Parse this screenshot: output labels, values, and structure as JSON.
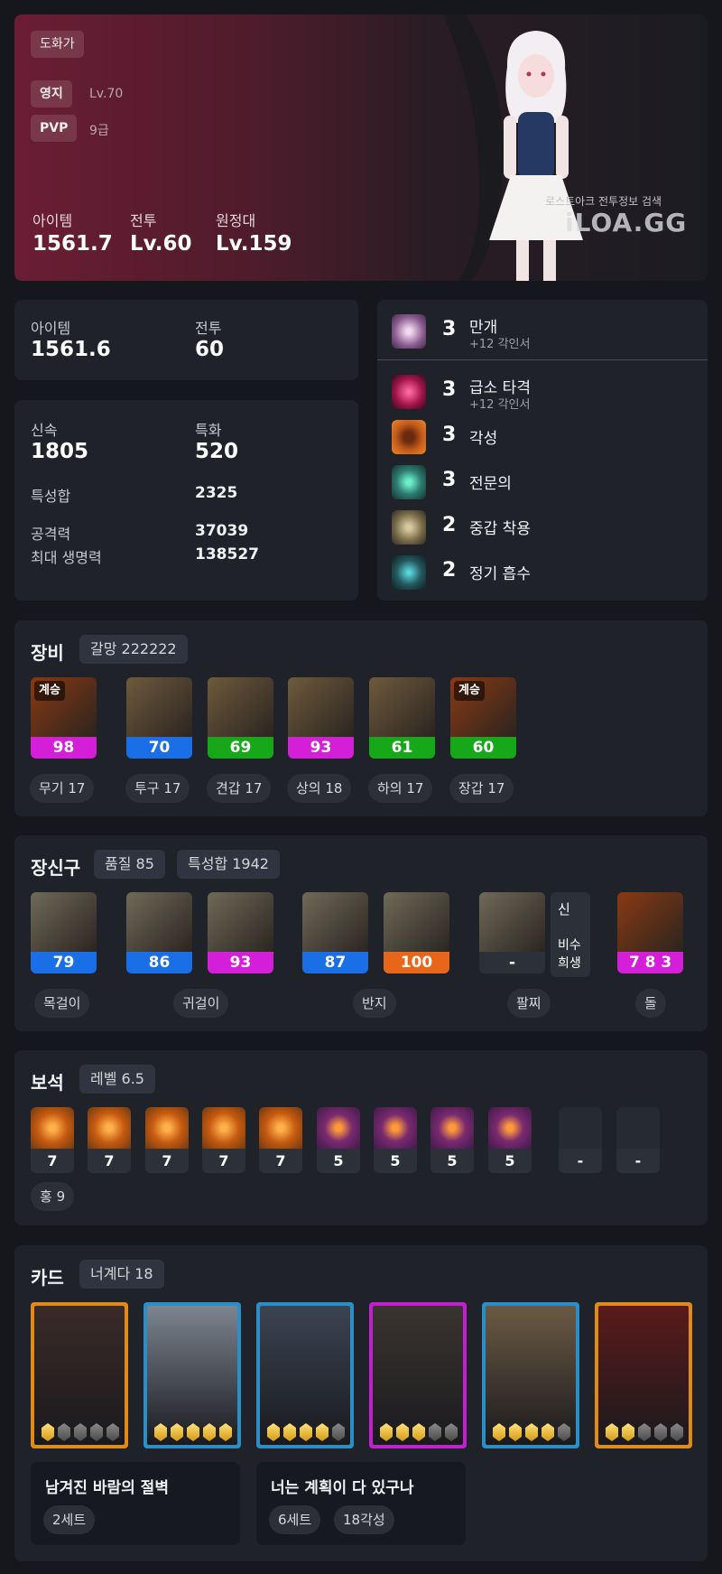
{
  "profile": {
    "class_tag": "도화가",
    "territory_label": "영지",
    "territory_value": "Lv.70",
    "pvp_label": "PVP",
    "pvp_value": "9급",
    "stats": [
      {
        "label": "아이템",
        "value": "1561.7"
      },
      {
        "label": "전투",
        "value": "Lv.60"
      },
      {
        "label": "원정대",
        "value": "Lv.159"
      }
    ],
    "watermark_sub": "로스트아크 전투정보 검색",
    "watermark_brand": "iLOA.GG"
  },
  "summary": {
    "item_label": "아이템",
    "item_value": "1561.6",
    "combat_label": "전투",
    "combat_value": "60"
  },
  "combat_stats": {
    "swift_label": "신속",
    "swift_value": "1805",
    "crit_label": "특화",
    "crit_value": "520",
    "total_label": "특성합",
    "total_value": "2325",
    "atk_label": "공격력",
    "atk_value": "37039",
    "hp_label": "최대 생명력",
    "hp_value": "138527"
  },
  "engravings": [
    {
      "level": "3",
      "name": "만개",
      "sub": "+12 각인서",
      "icon": "bloom-icon",
      "color": "#8a5a8f"
    },
    {
      "level": "3",
      "name": "급소 타격",
      "sub": "+12 각인서",
      "icon": "vital-strike-icon",
      "color": "#a2154a"
    },
    {
      "level": "3",
      "name": "각성",
      "sub": "",
      "icon": "awakening-icon",
      "color": "#c25a1a"
    },
    {
      "level": "3",
      "name": "전문의",
      "sub": "",
      "icon": "specialist-icon",
      "color": "#2f7d73"
    },
    {
      "level": "2",
      "name": "중갑 착용",
      "sub": "",
      "icon": "heavy-armor-icon",
      "color": "#7b6d4b"
    },
    {
      "level": "2",
      "name": "정기 흡수",
      "sub": "",
      "icon": "spirit-absorption-icon",
      "color": "#255a5f"
    }
  ],
  "equipment": {
    "title": "장비",
    "badge": "갈망 222222",
    "items": [
      {
        "quality": "98",
        "label": "무기 17",
        "inherit": "계승",
        "qcolor": "#d41ed8",
        "bg": "#8a3a12",
        "icon": "weapon-icon"
      },
      {
        "quality": "70",
        "label": "투구 17",
        "inherit": "",
        "qcolor": "#1b6fe6",
        "bg": "#6e5a3c",
        "icon": "helmet-icon"
      },
      {
        "quality": "69",
        "label": "견갑 17",
        "inherit": "",
        "qcolor": "#17a81a",
        "bg": "#6e5a3c",
        "icon": "shoulder-icon"
      },
      {
        "quality": "93",
        "label": "상의 18",
        "inherit": "",
        "qcolor": "#d41ed8",
        "bg": "#6e5a3c",
        "icon": "chest-icon"
      },
      {
        "quality": "61",
        "label": "하의 17",
        "inherit": "",
        "qcolor": "#17a81a",
        "bg": "#6e5a3c",
        "icon": "pants-icon"
      },
      {
        "quality": "60",
        "label": "장갑 17",
        "inherit": "계승",
        "qcolor": "#17a81a",
        "bg": "#8a3a12",
        "icon": "gloves-icon"
      }
    ]
  },
  "accessories": {
    "title": "장신구",
    "badge_quality": "품질 85",
    "badge_stats": "특성합 1942",
    "items": [
      {
        "quality": "79",
        "qcolor": "#1b6fe6",
        "icon": "necklace-icon"
      },
      {
        "quality": "86",
        "qcolor": "#1b6fe6",
        "icon": "earring-icon"
      },
      {
        "quality": "93",
        "qcolor": "#d41ed8",
        "icon": "earring-icon"
      },
      {
        "quality": "87",
        "qcolor": "#1b6fe6",
        "icon": "ring-icon"
      },
      {
        "quality": "100",
        "qcolor": "#e8661a",
        "icon": "ring-icon"
      },
      {
        "quality": "-",
        "qcolor": "#2c3038",
        "icon": "bracelet-icon"
      },
      {
        "quality": "7 8 3",
        "qcolor": "#d41ed8",
        "icon": "stone-icon"
      }
    ],
    "bracelet_tags": {
      "top": "신",
      "bottom_1": "비수",
      "bottom_2": "희생"
    },
    "labels": {
      "necklace": "목걸이",
      "earring": "귀걸이",
      "ring": "반지",
      "bracelet": "팔찌",
      "stone": "돌"
    }
  },
  "gems": {
    "title": "보석",
    "badge": "레벨 6.5",
    "items": [
      {
        "level": "7",
        "type": "orange"
      },
      {
        "level": "7",
        "type": "orange"
      },
      {
        "level": "7",
        "type": "orange"
      },
      {
        "level": "7",
        "type": "orange"
      },
      {
        "level": "7",
        "type": "orange"
      },
      {
        "level": "5",
        "type": "purple"
      },
      {
        "level": "5",
        "type": "purple"
      },
      {
        "level": "5",
        "type": "purple"
      },
      {
        "level": "5",
        "type": "purple"
      },
      {
        "level": "-",
        "type": "empty"
      },
      {
        "level": "-",
        "type": "empty"
      }
    ],
    "summary": "홍 9"
  },
  "cards": {
    "title": "카드",
    "badge": "너계다 18",
    "items": [
      {
        "border": "#e08a1a",
        "bg": "#3a2a28",
        "awakened": 1
      },
      {
        "border": "#2a8fc8",
        "bg": "#7d8590",
        "awakened": 5
      },
      {
        "border": "#2a8fc8",
        "bg": "#3a4452",
        "awakened": 4
      },
      {
        "border": "#c21fd1",
        "bg": "#3a3430",
        "awakened": 3
      },
      {
        "border": "#2a8fc8",
        "bg": "#6a5a44",
        "awakened": 4
      },
      {
        "border": "#e08a1a",
        "bg": "#5a1a1a",
        "awakened": 2
      }
    ],
    "sets": [
      {
        "name": "남겨진 바람의 절벽",
        "tags": [
          "2세트"
        ]
      },
      {
        "name": "너는 계획이 다 있구나",
        "tags": [
          "6세트",
          "18각성"
        ]
      }
    ]
  }
}
